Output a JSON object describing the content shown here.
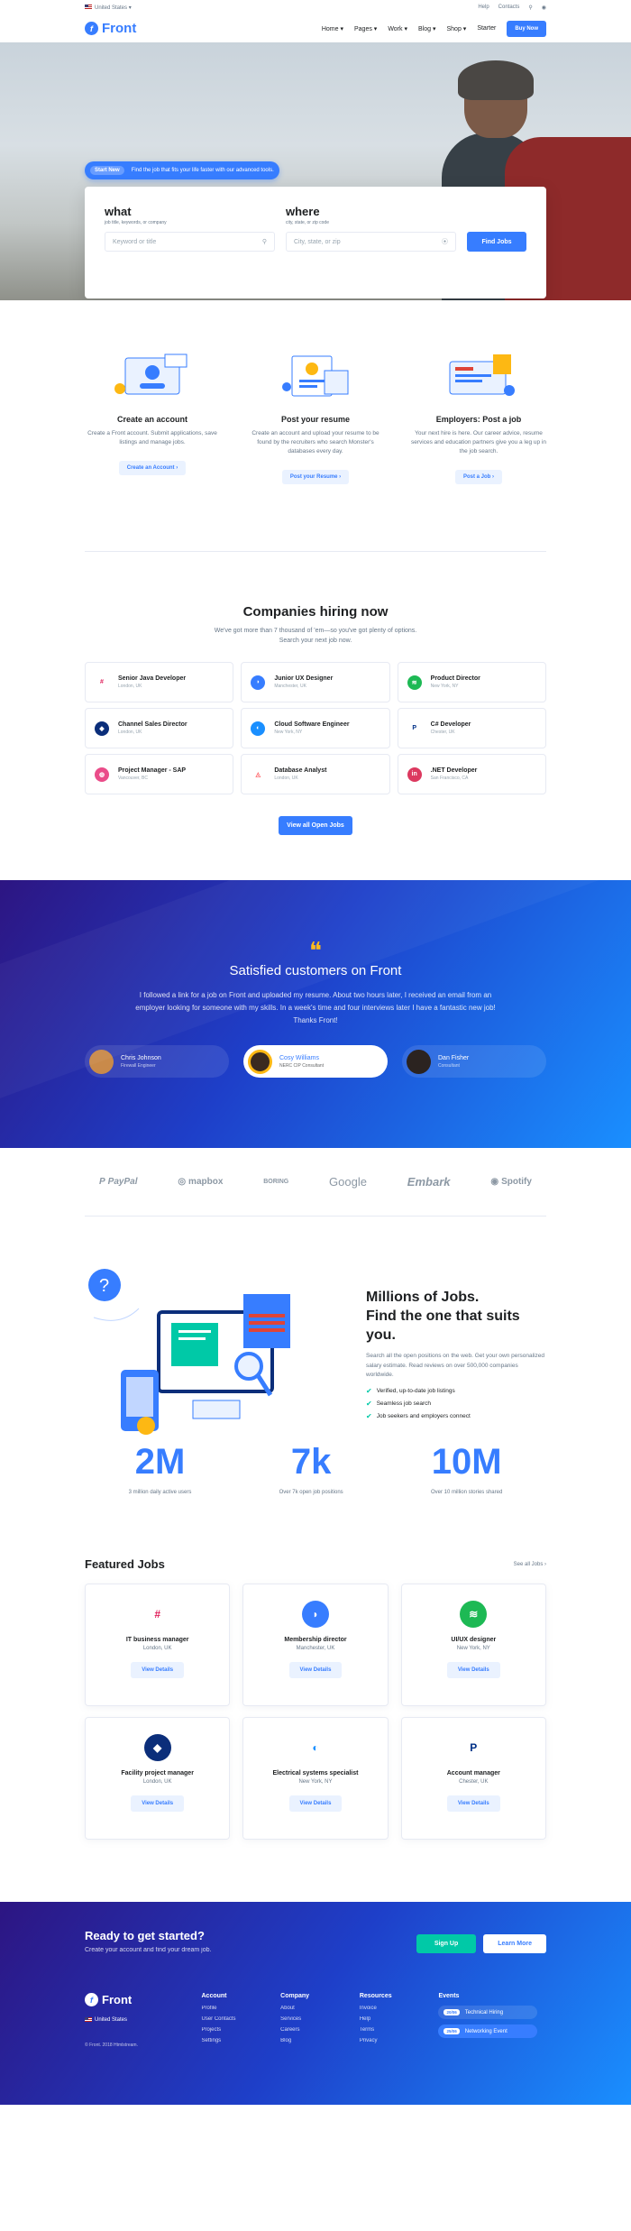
{
  "topbar": {
    "region": "United States",
    "help": "Help",
    "contacts": "Contacts"
  },
  "nav": {
    "brand": "Front",
    "items": [
      "Home",
      "Pages",
      "Work",
      "Blog",
      "Shop",
      "Starter"
    ],
    "buy": "Buy Now"
  },
  "hero": {
    "pill_tag": "Start New",
    "pill_text": "Find the job that fits your life faster with our advanced tools.",
    "what_label": "what",
    "what_hint": "job title, keywords, or company",
    "what_placeholder": "Keyword or title",
    "where_label": "where",
    "where_hint": "city, state, or zip code",
    "where_placeholder": "City, state, or zip",
    "find_btn": "Find Jobs"
  },
  "steps": [
    {
      "title": "Create an account",
      "text": "Create a Front account. Submit applications, save listings and manage jobs.",
      "btn": "Create an Account"
    },
    {
      "title": "Post your resume",
      "text": "Create an account and upload your resume to be found by the recruiters who search Monster's databases every day.",
      "btn": "Post your Resume"
    },
    {
      "title": "Employers: Post a job",
      "text": "Your next hire is here. Our career advice, resume services and education partners give you a leg up in the job search.",
      "btn": "Post a Job"
    }
  ],
  "companies": {
    "title": "Companies hiring now",
    "subtitle": "We've got more than 7 thousand of 'em—so you've got plenty of options. Search your next job now.",
    "jobs": [
      {
        "title": "Senior Java Developer",
        "location": "London, UK",
        "logo": "slack-icon",
        "color": "#ffffff"
      },
      {
        "title": "Junior UX Designer",
        "location": "Manchester, UK",
        "logo": "messenger-icon",
        "color": "#377dff"
      },
      {
        "title": "Product Director",
        "location": "New York, NY",
        "logo": "spotify-icon",
        "color": "#1db954"
      },
      {
        "title": "Channel Sales Director",
        "location": "London, UK",
        "logo": "dropbox-icon",
        "color": "#0b2e7a"
      },
      {
        "title": "Cloud Software Engineer",
        "location": "New York, NY",
        "logo": "cloud-icon",
        "color": "#1a8fff"
      },
      {
        "title": "C# Developer",
        "location": "Chester, UK",
        "logo": "paypal-icon",
        "color": "#ffffff"
      },
      {
        "title": "Project Manager - SAP",
        "location": "Vancouver, BC",
        "logo": "dribbble-icon",
        "color": "#ea4c89"
      },
      {
        "title": "Database Analyst",
        "location": "London, UK",
        "logo": "airbnb-icon",
        "color": "#ffffff"
      },
      {
        "title": ".NET Developer",
        "location": "San Francisco, CA",
        "logo": "invision-icon",
        "color": "#dc395f"
      }
    ],
    "view_all": "View all Open Jobs"
  },
  "testimonial": {
    "title": "Satisfied customers on Front",
    "quote": "I followed a link for a job on Front and uploaded my resume. About two hours later, I received an email from an employer looking for someone with my skills. In a week's time and four interviews later I have a fantastic new job! Thanks Front!",
    "authors": [
      {
        "name": "Chris Johnson",
        "role": "Firewall Engineer"
      },
      {
        "name": "Cosy Williams",
        "role": "NERC CIP Consultant"
      },
      {
        "name": "Dan Fisher",
        "role": "Consultant"
      }
    ]
  },
  "clients": [
    "PayPal",
    "mapbox",
    "BORING",
    "Google",
    "Embark",
    "Spotify"
  ],
  "millions": {
    "title": "Millions of Jobs.",
    "title2": "Find the one that suits you.",
    "text": "Search all the open positions on the web. Get your own personalized salary estimate. Read reviews on over 500,000 companies worldwide.",
    "checks": [
      "Verified, up-to-date job listings",
      "Seamless job search",
      "Job seekers and employers connect"
    ]
  },
  "stats": [
    {
      "value": "2M",
      "label": "3 million daily active users"
    },
    {
      "value": "7k",
      "label": "Over 7k open job positions"
    },
    {
      "value": "10M",
      "label": "Over 10 million stories shared"
    }
  ],
  "featured": {
    "title": "Featured Jobs",
    "see_all": "See all Jobs",
    "jobs": [
      {
        "title": "IT business manager",
        "location": "London, UK",
        "logo": "slack-icon"
      },
      {
        "title": "Membership director",
        "location": "Manchester, UK",
        "logo": "messenger-icon"
      },
      {
        "title": "UI/UX designer",
        "location": "New York, NY",
        "logo": "spotify-icon"
      },
      {
        "title": "Facility project manager",
        "location": "London, UK",
        "logo": "dropbox-icon"
      },
      {
        "title": "Electrical systems specialist",
        "location": "New York, NY",
        "logo": "cloud-icon"
      },
      {
        "title": "Account manager",
        "location": "Chester, UK",
        "logo": "paypal-icon"
      }
    ],
    "btn": "View Details"
  },
  "footer": {
    "cta_title": "Ready to get started?",
    "cta_text": "Create your account and find your dream job.",
    "signup": "Sign Up",
    "learn": "Learn More",
    "brand": "Front",
    "region": "United States",
    "copyright": "© Front. 2018 Htmlstream.",
    "cols": [
      {
        "title": "Account",
        "items": [
          "Profile",
          "User Contacts",
          "Projects",
          "Settings"
        ]
      },
      {
        "title": "Company",
        "items": [
          "About",
          "Services",
          "Careers",
          "Blog"
        ]
      },
      {
        "title": "Resources",
        "items": [
          "Invoice",
          "Help",
          "Terms",
          "Privacy"
        ]
      }
    ],
    "events_title": "Events",
    "events": [
      {
        "tag": "20/06",
        "label": "Technical Hiring"
      },
      {
        "tag": "25/06",
        "label": "Networking Event"
      }
    ]
  }
}
